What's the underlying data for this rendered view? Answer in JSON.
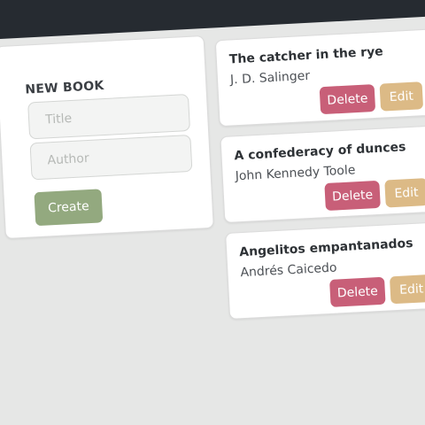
{
  "new_book": {
    "heading": "NEW BOOK",
    "title_placeholder": "Title",
    "author_placeholder": "Author",
    "create_label": "Create"
  },
  "books": [
    {
      "title": "The catcher in the rye",
      "author": "J. D. Salinger",
      "delete_label": "Delete",
      "edit_label": "Edit"
    },
    {
      "title": "A confederacy of dunces",
      "author": "John Kennedy Toole",
      "delete_label": "Delete",
      "edit_label": "Edit"
    },
    {
      "title": "Angelitos empantanados",
      "author": "Andrés Caicedo",
      "delete_label": "Delete",
      "edit_label": "Edit"
    }
  ],
  "colors": {
    "topbar": "#262b31",
    "create": "#93a97f",
    "delete": "#c85f78",
    "edit": "#dcba86"
  }
}
